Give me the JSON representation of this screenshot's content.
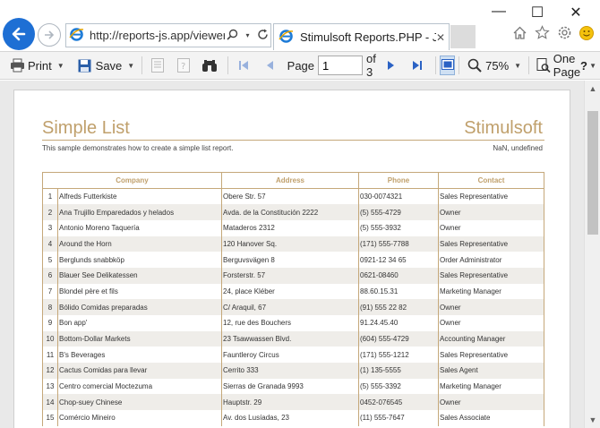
{
  "browser": {
    "url": "http://reports-js.app/viewer",
    "tab_title": "Stimulsoft Reports.PHP - JS...",
    "tab_close": "✕",
    "window_controls": [
      "—",
      "☐",
      "✕"
    ]
  },
  "toolbar": {
    "print_label": "Print",
    "save_label": "Save",
    "page_label": "Page",
    "page_value": "1",
    "page_of": "of 3",
    "zoom_label": "75%",
    "view_mode_label": "One Page",
    "help_label": "?"
  },
  "report": {
    "title": "Simple List",
    "brand": "Stimulsoft",
    "description": "This sample demonstrates how to create a simple list report.",
    "date_text": "NaN, undefined",
    "columns": [
      "Company",
      "Address",
      "Phone",
      "Contact"
    ],
    "rows": [
      {
        "n": "1",
        "company": "Alfreds Futterkiste",
        "address": "Obere Str. 57",
        "phone": "030-0074321",
        "contact": "Sales Representative"
      },
      {
        "n": "2",
        "company": "Ana Trujillo Emparedados y helados",
        "address": "Avda. de la Constitución 2222",
        "phone": "(5) 555-4729",
        "contact": "Owner"
      },
      {
        "n": "3",
        "company": "Antonio Moreno Taquería",
        "address": "Mataderos 2312",
        "phone": "(5) 555-3932",
        "contact": "Owner"
      },
      {
        "n": "4",
        "company": "Around the Horn",
        "address": "120 Hanover Sq.",
        "phone": "(171) 555-7788",
        "contact": "Sales Representative"
      },
      {
        "n": "5",
        "company": "Berglunds snabbköp",
        "address": "Berguvsvägen 8",
        "phone": "0921-12 34 65",
        "contact": "Order Administrator"
      },
      {
        "n": "6",
        "company": "Blauer See Delikatessen",
        "address": "Forsterstr. 57",
        "phone": "0621-08460",
        "contact": "Sales Representative"
      },
      {
        "n": "7",
        "company": "Blondel père et fils",
        "address": "24, place Kléber",
        "phone": "88.60.15.31",
        "contact": "Marketing Manager"
      },
      {
        "n": "8",
        "company": "Bólido Comidas preparadas",
        "address": "C/ Araquil, 67",
        "phone": "(91) 555 22 82",
        "contact": "Owner"
      },
      {
        "n": "9",
        "company": "Bon app'",
        "address": "12, rue des Bouchers",
        "phone": "91.24.45.40",
        "contact": "Owner"
      },
      {
        "n": "10",
        "company": "Bottom-Dollar Markets",
        "address": "23 Tsawwassen Blvd.",
        "phone": "(604) 555-4729",
        "contact": "Accounting Manager"
      },
      {
        "n": "11",
        "company": "B's Beverages",
        "address": "Fauntleroy Circus",
        "phone": "(171) 555-1212",
        "contact": "Sales Representative"
      },
      {
        "n": "12",
        "company": "Cactus Comidas para llevar",
        "address": "Cerrito 333",
        "phone": "(1) 135-5555",
        "contact": "Sales Agent"
      },
      {
        "n": "13",
        "company": "Centro comercial Moctezuma",
        "address": "Sierras de Granada 9993",
        "phone": "(5) 555-3392",
        "contact": "Marketing Manager"
      },
      {
        "n": "14",
        "company": "Chop-suey Chinese",
        "address": "Hauptstr. 29",
        "phone": "0452-076545",
        "contact": "Owner"
      },
      {
        "n": "15",
        "company": "Comércio Mineiro",
        "address": "Av. dos Lusíadas, 23",
        "phone": "(11) 555-7647",
        "contact": "Sales Associate"
      }
    ]
  },
  "colors": {
    "accent": "#c0a06c",
    "even_row": "#efede9",
    "back_button": "#1e6fd4"
  }
}
